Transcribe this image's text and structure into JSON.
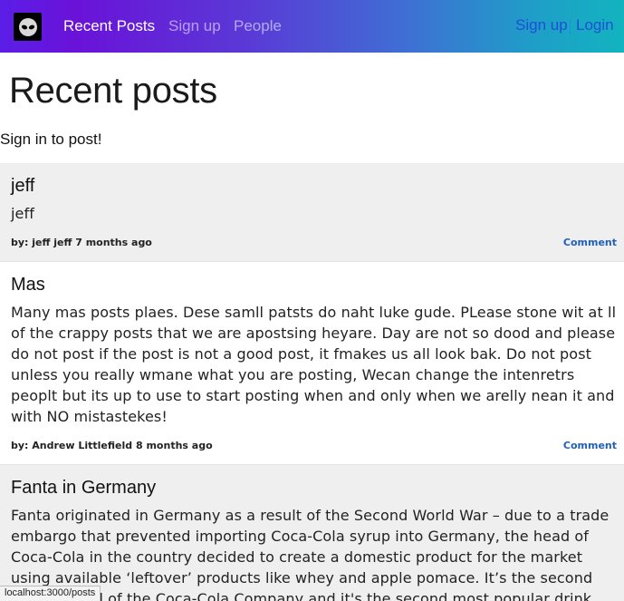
{
  "nav": {
    "links": [
      "Recent Posts",
      "Sign up",
      "People"
    ],
    "right_signup": "Sign up",
    "right_login": "Login"
  },
  "page": {
    "title": "Recent posts",
    "signin_message": "Sign in to post!"
  },
  "posts": [
    {
      "title": "jeff",
      "body": "jeff",
      "meta": "by: jeff jeff 7 months ago",
      "comment_label": "Comment"
    },
    {
      "title": "Mas",
      "body": "Many mas posts plaes. Dese samll patsts do naht luke gude. PLease stone wit at ll of the crappy posts that we are apostsing heyare. Day are not so dood and please do not post if the post is not a good post, it fmakes us all look bak. Do not post unless you really wmane what you are posting, Wecan change the intenretrs peoplt but its up to use to start posting when and only when we arelly nean it and with NO mistastekes!",
      "meta": "by: Andrew Littlefield 8 months ago",
      "comment_label": "Comment"
    },
    {
      "title": "Fanta in Germany",
      "body": "Fanta originated in Germany as a result of the Second World War – due to a trade embargo that prevented importing Coca-Cola syrup into Germany, the head of Coca-Cola in the country decided to create a domestic product for the market using available ‘leftover’ products like whey and apple pomace. It’s the second oldest brand of the Coca-Cola Company and it's the second most popular drink outside of the United States. It’s",
      "meta": "",
      "comment_label": ""
    }
  ],
  "status_bar": {
    "url": "localhost:3000/posts"
  },
  "colors": {
    "nav_gradient_start": "#5b1ee8",
    "nav_gradient_end": "#12b4c0",
    "link_blue": "#1f5fbf",
    "shaded_post": "#efefef"
  }
}
